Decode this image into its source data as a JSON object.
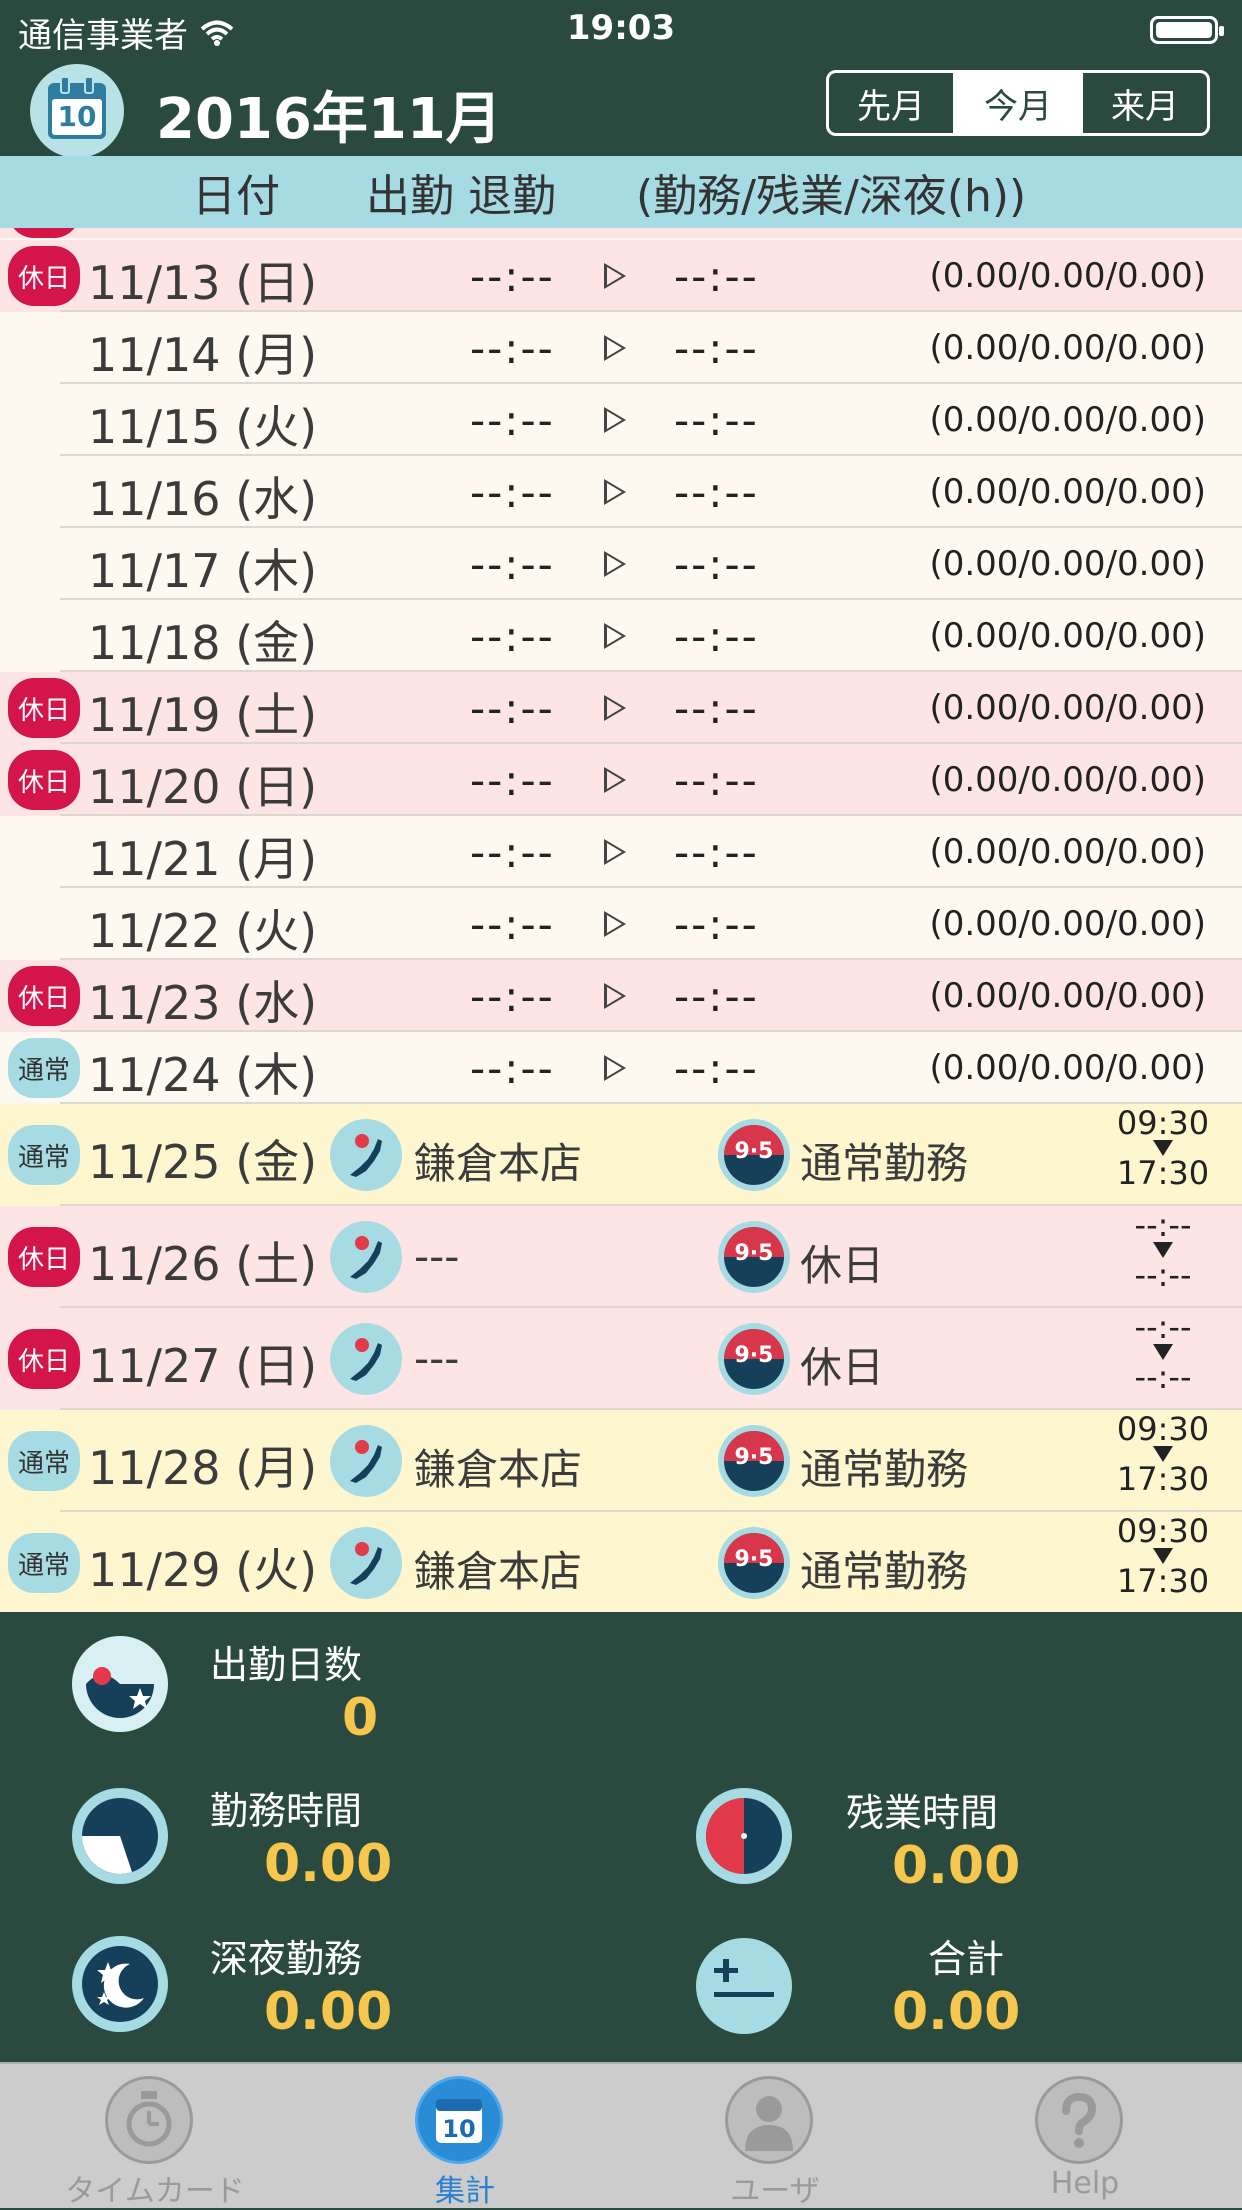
{
  "status_bar": {
    "carrier": "通信事業者",
    "time": "19:03"
  },
  "header": {
    "title": "2016年11月",
    "calendar_day": "10",
    "segments": [
      {
        "label": "先月",
        "active": false
      },
      {
        "label": "今月",
        "active": true
      },
      {
        "label": "来月",
        "active": false
      }
    ]
  },
  "columns": {
    "date": "日付",
    "in_out": "出勤 退勤",
    "hours": "(勤務/残業/深夜(h))"
  },
  "simple_rows": [
    {
      "badge": "休日",
      "badge_type": "hol",
      "bg": "h",
      "date": "11/13",
      "dow": "(日)",
      "time_in": "--:--",
      "time_out": "--:--",
      "hours": "(0.00/0.00/0.00)"
    },
    {
      "badge": "",
      "badge_type": "",
      "bg": "w",
      "date": "11/14",
      "dow": "(月)",
      "time_in": "--:--",
      "time_out": "--:--",
      "hours": "(0.00/0.00/0.00)"
    },
    {
      "badge": "",
      "badge_type": "",
      "bg": "w",
      "date": "11/15",
      "dow": "(火)",
      "time_in": "--:--",
      "time_out": "--:--",
      "hours": "(0.00/0.00/0.00)"
    },
    {
      "badge": "",
      "badge_type": "",
      "bg": "w",
      "date": "11/16",
      "dow": "(水)",
      "time_in": "--:--",
      "time_out": "--:--",
      "hours": "(0.00/0.00/0.00)"
    },
    {
      "badge": "",
      "badge_type": "",
      "bg": "w",
      "date": "11/17",
      "dow": "(木)",
      "time_in": "--:--",
      "time_out": "--:--",
      "hours": "(0.00/0.00/0.00)"
    },
    {
      "badge": "",
      "badge_type": "",
      "bg": "w",
      "date": "11/18",
      "dow": "(金)",
      "time_in": "--:--",
      "time_out": "--:--",
      "hours": "(0.00/0.00/0.00)"
    },
    {
      "badge": "休日",
      "badge_type": "hol",
      "bg": "h",
      "date": "11/19",
      "dow": "(土)",
      "time_in": "--:--",
      "time_out": "--:--",
      "hours": "(0.00/0.00/0.00)"
    },
    {
      "badge": "休日",
      "badge_type": "hol",
      "bg": "h",
      "date": "11/20",
      "dow": "(日)",
      "time_in": "--:--",
      "time_out": "--:--",
      "hours": "(0.00/0.00/0.00)"
    },
    {
      "badge": "",
      "badge_type": "",
      "bg": "w",
      "date": "11/21",
      "dow": "(月)",
      "time_in": "--:--",
      "time_out": "--:--",
      "hours": "(0.00/0.00/0.00)"
    },
    {
      "badge": "",
      "badge_type": "",
      "bg": "w",
      "date": "11/22",
      "dow": "(火)",
      "time_in": "--:--",
      "time_out": "--:--",
      "hours": "(0.00/0.00/0.00)"
    },
    {
      "badge": "休日",
      "badge_type": "hol",
      "bg": "h",
      "date": "11/23",
      "dow": "(水)",
      "time_in": "--:--",
      "time_out": "--:--",
      "hours": "(0.00/0.00/0.00)"
    },
    {
      "badge": "通常",
      "badge_type": "nor",
      "bg": "w",
      "date": "11/24",
      "dow": "(木)",
      "time_in": "--:--",
      "time_out": "--:--",
      "hours": "(0.00/0.00/0.00)"
    }
  ],
  "plan_rows": [
    {
      "badge": "通常",
      "badge_type": "nor",
      "bg": "y",
      "date": "11/25",
      "dow": "(金)",
      "shop": "鎌倉本店",
      "shift": "通常勤務",
      "start": "09:30",
      "end": "17:30"
    },
    {
      "badge": "休日",
      "badge_type": "hol",
      "bg": "h",
      "date": "11/26",
      "dow": "(土)",
      "shop": "---",
      "shift": "休日",
      "start": "--:--",
      "end": "--:--"
    },
    {
      "badge": "休日",
      "badge_type": "hol",
      "bg": "h",
      "date": "11/27",
      "dow": "(日)",
      "shop": "---",
      "shift": "休日",
      "start": "--:--",
      "end": "--:--"
    },
    {
      "badge": "通常",
      "badge_type": "nor",
      "bg": "y",
      "date": "11/28",
      "dow": "(月)",
      "shop": "鎌倉本店",
      "shift": "通常勤務",
      "start": "09:30",
      "end": "17:30"
    },
    {
      "badge": "通常",
      "badge_type": "nor",
      "bg": "y",
      "date": "11/29",
      "dow": "(火)",
      "shop": "鎌倉本店",
      "shift": "通常勤務",
      "start": "09:30",
      "end": "17:30"
    }
  ],
  "summary": {
    "days_label": "出勤日数",
    "days_value": "0",
    "work_label": "勤務時間",
    "work_value": "0.00",
    "overtime_label": "残業時間",
    "overtime_value": "0.00",
    "night_label": "深夜勤務",
    "night_value": "0.00",
    "total_label": "合計",
    "total_value": "0.00"
  },
  "tabs": [
    {
      "label": "タイムカード",
      "active": false,
      "icon": "stopwatch-icon"
    },
    {
      "label": "集計",
      "active": true,
      "icon": "calendar-icon"
    },
    {
      "label": "ユーザ",
      "active": false,
      "icon": "user-icon"
    },
    {
      "label": "Help",
      "active": false,
      "icon": "help-icon"
    }
  ],
  "colors": {
    "dark_green": "#2a4a3f",
    "header_blue": "#a6dbe3",
    "holiday_red": "#d3154a",
    "accent_yellow": "#f7c64d"
  }
}
